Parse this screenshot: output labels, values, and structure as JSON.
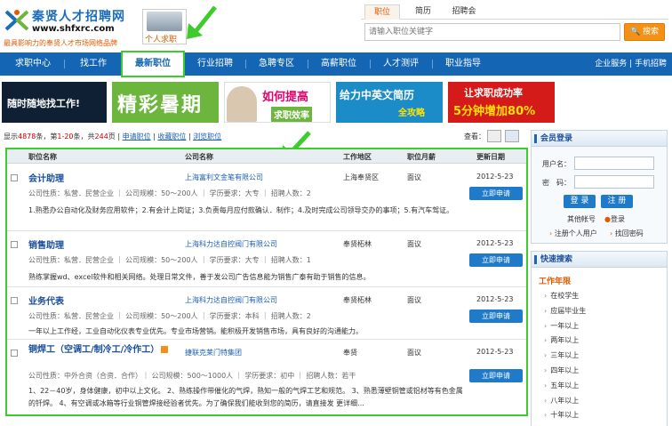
{
  "header": {
    "logo_title": "秦贤人才招聘网",
    "logo_url": "www.shfxrc.com",
    "logo_slogan": "最具影响力的奉贤人才市场网络品牌",
    "personal_label": "个人求职"
  },
  "search": {
    "tabs": [
      "职位",
      "简历",
      "招聘会"
    ],
    "active_tab": "职位",
    "placeholder": "请输入职位关键字",
    "button_label": "搜索"
  },
  "nav": {
    "items": [
      "求职中心",
      "找工作",
      "最新职位",
      "行业招聘",
      "急聘专区",
      "高薪职位",
      "人才测评",
      "职业指导"
    ],
    "active": "最新职位",
    "right": "企业服务 | 手机招聘"
  },
  "banners": [
    {
      "text": "随时随地找工作!",
      "color": "#ffffff",
      "bg": "#0f1f34"
    },
    {
      "text": "精彩暑期",
      "color": "#ffffff",
      "bg": "#6cb63d"
    },
    {
      "text": "如何提高",
      "sub": "求职效率",
      "color": "#e4006e",
      "bg": "#ffffff"
    },
    {
      "text": "给力中英文简历",
      "sub": "全攻略",
      "color": "#ffffff",
      "bg": "#1c8cc8"
    },
    {
      "text": "让求职成功率",
      "sub": "5分钟增加80%",
      "color": "#ffffff",
      "bg": "#d51a1a"
    }
  ],
  "toolbar": {
    "count_prefix": "显示",
    "count_total": "4878",
    "count_mid": "条，第",
    "count_range": "1-20",
    "count_mid2": "条，共",
    "count_pages": "244",
    "count_suffix": "页 |",
    "apply": "申请职位",
    "sep1": "|",
    "favorite": "收藏职位",
    "sep2": "|",
    "browse": "浏览职位",
    "view_label": "查看："
  },
  "table_headers": [
    "职位名称",
    "公司名称",
    "工作地区",
    "职位月薪",
    "更新日期"
  ],
  "jobs": [
    {
      "title": "会计助理",
      "company": "上海富利文金笔有限公司",
      "area": "上海奉贤区",
      "salary": "面议",
      "date": "2012-5-23",
      "meta": "公司性质：私营．民营企业 ｜ 公司规模：50～200人 ｜ 学历要求：大专 ｜ 招聘人数：2",
      "apply": "立即申请",
      "desc": "1.熟悉办公自动化及财务应用软件；2.有会计上岗证；3.负责每月应付款确认．制作；4.及时完成公司领导交办的事项；5.有汽车驾证。",
      "new": false
    },
    {
      "title": "销售助理",
      "company": "上海科力达自控阀门有限公司",
      "area": "奉贤柘林",
      "salary": "面议",
      "date": "2012-5-23",
      "meta": "公司性质：私营．民营企业 ｜ 公司规模：50～200人 ｜ 学历要求：大专 ｜ 招聘人数：1",
      "apply": "立即申请",
      "desc": "熟练掌握wd、excel软件和相关网络。处理日常文件，善于发公司广告信息能为销售广泰有助于销售的信息。",
      "new": false
    },
    {
      "title": "业务代表",
      "company": "上海科力达自控阀门有限公司",
      "area": "奉贤柘林",
      "salary": "面议",
      "date": "2012-5-23",
      "meta": "公司性质：私营．民营企业 ｜ 公司规模：50～200人 ｜ 学历要求：本科 ｜ 招聘人数：2",
      "apply": "立即申请",
      "desc": "一年以上工作经，工业自动化仪表专业优先。专业市场营销。能积极开发销售市场，具有良好的沟通能力。",
      "new": false
    },
    {
      "title": "铜焊工（空调工/制冷工/冷作工）",
      "company": "捷联克莱门特集团",
      "area": "奉贤",
      "salary": "面议",
      "date": "2012-5-23",
      "meta": "公司性质：中外合资（合资．合作）｜ 公司规模：500～1000人 ｜ 学历要求：初中 ｜ 招聘人数：若干",
      "apply": "立即申请",
      "desc": "1、22－40岁，身体健康，初中以上文化。 2、熟练操作带催化的气焊，熟知一般的气焊工艺和规范。 3、熟悉薄壁铜管或铝材等有色金属的钎焊。 4、有空调或冰箱等行业铜管焊接经验者优先。为了确保我们能收到您的简历，请直接发 更详细...",
      "new": true
    }
  ],
  "login": {
    "title": "会员登录",
    "username_label": "用户名：",
    "password_label": "密　码：",
    "login_btn": "登 录",
    "register_btn": "注 册",
    "other_account": "其他帐号",
    "qq_login": "登录",
    "register_personal": "注册个人用户",
    "find_password": "找回密码"
  },
  "quick": {
    "title": "快速搜索",
    "subtitle": "工作年限",
    "items": [
      "在校学生",
      "应届毕业生",
      "一年以上",
      "两年以上",
      "三年以上",
      "四年以上",
      "五年以上",
      "八年以上",
      "十年以上"
    ]
  },
  "colors": {
    "nav_bg": "#1466b5",
    "highlight": "#3ecb2c",
    "accent_orange": "#f49015",
    "link_blue": "#1a5fb4"
  }
}
